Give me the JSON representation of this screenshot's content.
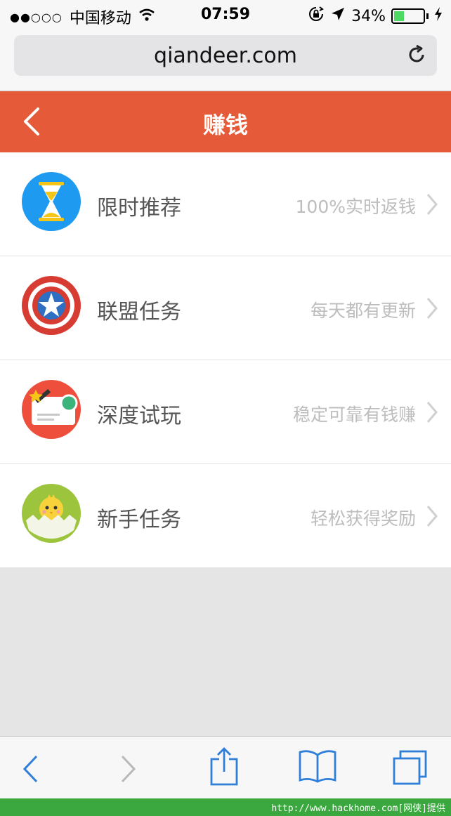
{
  "status_bar": {
    "signal": "●●○○○",
    "carrier": "中国移动",
    "time": "07:59",
    "battery": "34%",
    "battery_level": 0.34,
    "icons": [
      "wifi-icon",
      "rotation-lock-icon",
      "location-icon",
      "battery-icon",
      "charging-icon"
    ]
  },
  "browser": {
    "url": "qiandeer.com",
    "reload_icon": "reload-icon"
  },
  "header": {
    "title": "赚钱",
    "back_icon": "back-chevron-icon",
    "color": "#e55a38"
  },
  "menu": {
    "items": [
      {
        "title": "限时推荐",
        "subtitle": "100%实时返钱",
        "icon": "hourglass-icon"
      },
      {
        "title": "联盟任务",
        "subtitle": "每天都有更新",
        "icon": "shield-star-icon"
      },
      {
        "title": "深度试玩",
        "subtitle": "稳定可靠有钱赚",
        "icon": "card-icon"
      },
      {
        "title": "新手任务",
        "subtitle": "轻松获得奖励",
        "icon": "chick-icon"
      }
    ]
  },
  "toolbar": {
    "icons": [
      "back-icon",
      "forward-icon",
      "share-icon",
      "bookmarks-icon",
      "tabs-icon"
    ],
    "accent": "#2f7fd9"
  },
  "watermark": {
    "text": "http://www.hackhome.com[网侠]提供"
  }
}
